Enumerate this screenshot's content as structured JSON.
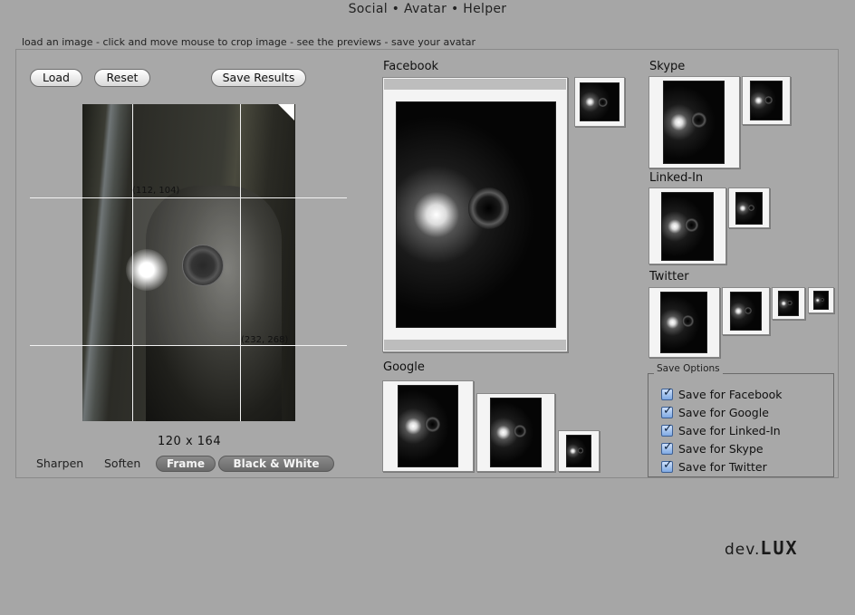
{
  "window": {
    "title": "Social • Avatar • Helper"
  },
  "instructions": "load an image - click and move mouse to crop image - see the previews - save your avatar",
  "toolbar": {
    "load": "Load",
    "reset": "Reset",
    "save_results": "Save Results"
  },
  "crop": {
    "top_left": "(112, 104)",
    "bottom_right": "(232, 268)",
    "size": "120  x  164"
  },
  "filters": {
    "sharpen": "Sharpen",
    "soften": "Soften",
    "frame": "Frame",
    "black_white": "Black & White"
  },
  "previews": {
    "facebook": "Facebook",
    "google": "Google",
    "skype": "Skype",
    "linkedin": "Linked-In",
    "twitter": "Twitter"
  },
  "save_options": {
    "legend": "Save Options",
    "items": [
      {
        "label": "Save for Facebook",
        "checked": true
      },
      {
        "label": "Save for Google",
        "checked": true
      },
      {
        "label": "Save for Linked-In",
        "checked": true
      },
      {
        "label": "Save for Skype",
        "checked": true
      },
      {
        "label": "Save for Twitter",
        "checked": true
      }
    ]
  },
  "logo": {
    "prefix": "dev.",
    "name": "LUX"
  }
}
